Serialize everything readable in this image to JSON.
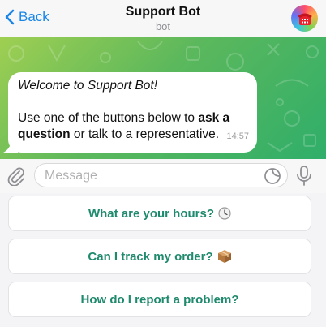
{
  "header": {
    "back_label": "Back",
    "title": "Support Bot",
    "subtitle": "bot"
  },
  "message": {
    "welcome": "Welcome to Support Bot!",
    "body_prefix": "Use one of the buttons below to ",
    "body_bold": "ask a question",
    "body_suffix": " or talk to a representative.",
    "time": "14:57"
  },
  "composer": {
    "placeholder": "Message"
  },
  "keyboard": {
    "buttons": [
      {
        "label": "What are your hours?",
        "icon": "clock-icon"
      },
      {
        "label": "Can I track my order?",
        "icon": "package-icon"
      },
      {
        "label": "How do I report a problem?"
      }
    ]
  },
  "colors": {
    "accent": "#1a86e8",
    "button_text": "#1f8a6d",
    "chat_gradient_start": "#9fcf52",
    "chat_gradient_end": "#2fae6a"
  }
}
